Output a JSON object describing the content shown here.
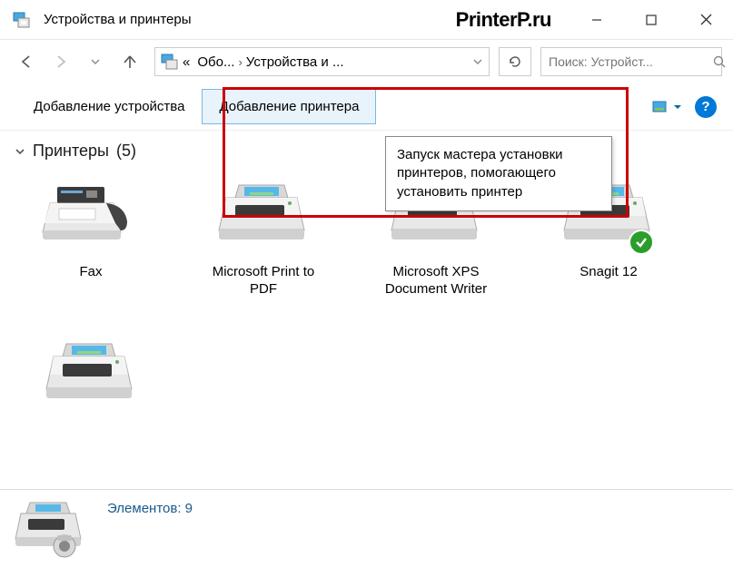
{
  "window": {
    "title": "Устройства и принтеры",
    "watermark": "PrinterP.ru"
  },
  "nav": {
    "path_root": "Обо...",
    "path_current": "Устройства и ...",
    "search_placeholder": "Поиск: Устройст..."
  },
  "toolbar": {
    "add_device": "Добавление устройства",
    "add_printer": "Добавление принтера"
  },
  "tooltip": {
    "text": "Запуск мастера установки принтеров, помогающего установить принтер"
  },
  "section": {
    "title": "Принтеры",
    "count": "(5)"
  },
  "devices": [
    {
      "label": "Fax",
      "type": "fax",
      "default": false
    },
    {
      "label": "Microsoft Print to PDF",
      "type": "printer",
      "default": false
    },
    {
      "label": "Microsoft XPS Document Writer",
      "type": "printer",
      "default": false
    },
    {
      "label": "Snagit 12",
      "type": "printer",
      "default": true
    },
    {
      "label": "",
      "type": "printer",
      "default": false
    }
  ],
  "status": {
    "elements": "Элементов: 9"
  }
}
